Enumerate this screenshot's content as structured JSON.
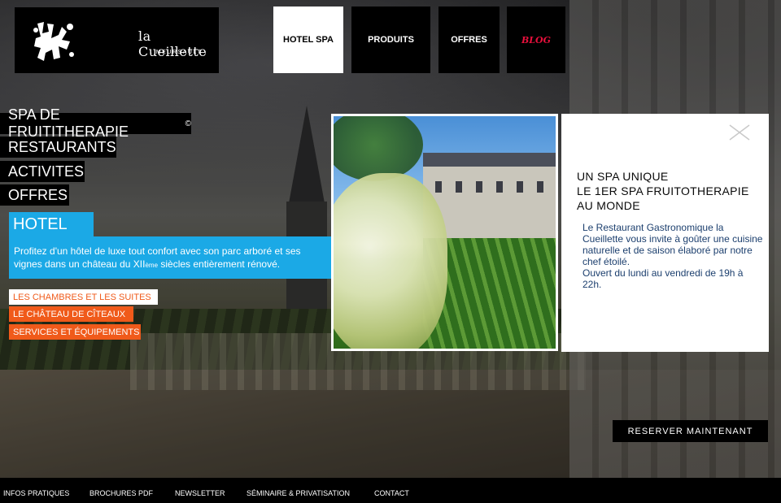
{
  "logo": {
    "name": "la Cueillette",
    "subtitle": ". MEURSAULT ."
  },
  "topnav": [
    {
      "label": "HOTEL SPA",
      "active": true
    },
    {
      "label": "PRODUITS",
      "active": false
    },
    {
      "label": "OFFRES",
      "active": false
    },
    {
      "label": "BLOG",
      "active": false
    }
  ],
  "sidenav": [
    {
      "label": "SPA DE FRUITITHERAPIE",
      "mark": "©"
    },
    {
      "label": "RESTAURANTS"
    },
    {
      "label": "ACTIVITES"
    },
    {
      "label": "OFFRES"
    }
  ],
  "hotel": {
    "title": "HOTEL",
    "desc_a": "Profitez d'un hôtel de luxe tout confort avec son parc arboré et ses vignes dans un château du XII",
    "desc_sup": "ème",
    "desc_b": " siècles entièrement rénové.",
    "links": [
      "LES CHAMBRES ET LES SUITES",
      "LE CHÂTEAU DE CÎTEAUX",
      "SERVICES ET ÉQUIPEMENTS"
    ]
  },
  "info": {
    "title_lines": [
      "UN SPA UNIQUE",
      "LE 1ER SPA FRUITOTHERAPIE",
      "AU MONDE"
    ],
    "body": "Le Restaurant Gastronomique la Cueillette vous invite à goûter une cuisine naturelle et de saison élaboré par notre chef étoilé.",
    "hours": "Ouvert du lundi au vendredi de 19h à 22h."
  },
  "reserve_label": "RESERVER MAINTENANT",
  "footer": [
    "INFOS PRATIQUES",
    "BROCHURES PDF",
    "NEWSLETTER",
    "SÉMINAIRE & PRIVATISATION",
    "CONTACT"
  ],
  "colors": {
    "accent_blue": "#1ba9e6",
    "accent_orange": "#f05a1a",
    "blog_red": "#e8103c"
  },
  "icons": [
    "logo-mark-icon",
    "close-icon"
  ]
}
